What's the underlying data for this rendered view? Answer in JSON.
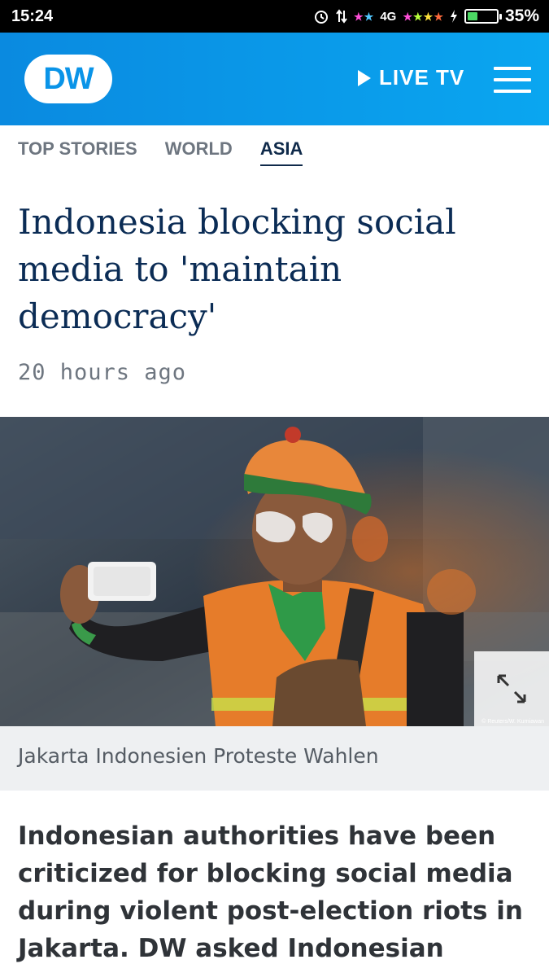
{
  "status_bar": {
    "time": "15:24",
    "network": "4G",
    "battery_percent": "35%",
    "battery_level": 0.35,
    "icons": [
      "alarm-icon",
      "data-transfer-icon",
      "signal-icon",
      "charging-icon",
      "battery-icon"
    ]
  },
  "header": {
    "logo_text": "DW",
    "live_tv_label": "LIVE TV",
    "accent_color": "#0a9be8"
  },
  "breadcrumbs": [
    {
      "label": "TOP STORIES",
      "active": false
    },
    {
      "label": "WORLD",
      "active": false
    },
    {
      "label": "ASIA",
      "active": true
    }
  ],
  "article": {
    "title": "Indonesia blocking social media to 'maintain democracy'",
    "timestamp": "20 hours ago",
    "image_caption": "Jakarta Indonesien Proteste Wahlen",
    "image_credit": "© Reuters/W. Kurniawan",
    "lead": "Indonesian authorities have been criticized for blocking social media during violent post-election riots in Jakarta. DW asked Indonesian"
  }
}
